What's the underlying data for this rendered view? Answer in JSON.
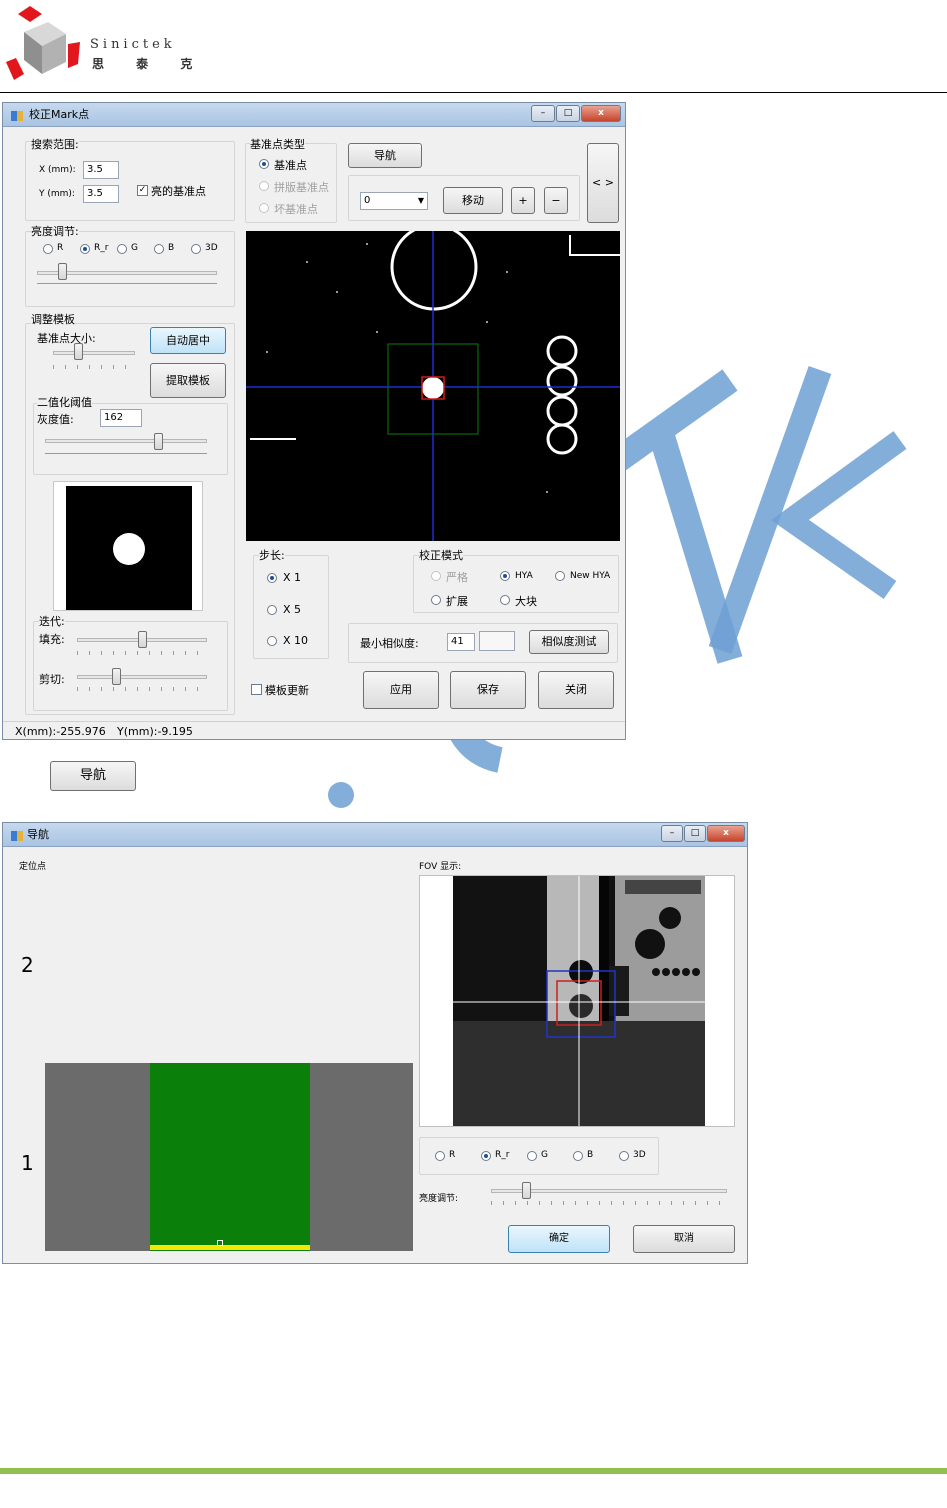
{
  "logo": {
    "name": "Sinictek",
    "cn": "思 泰 克"
  },
  "watermark": {
    "text": "Sinictek",
    "color": "#6ea0d3"
  },
  "win1": {
    "title": "校正Mark点",
    "search": {
      "title": "搜索范围:",
      "x_label": "X (mm):",
      "x_value": "3.5",
      "y_label": "Y (mm):",
      "y_value": "3.5",
      "bright_label": "亮的基准点",
      "bright_checked": true
    },
    "ref_type": {
      "title": "基准点类型",
      "opt1": "基准点",
      "opt2": "拼版基准点",
      "opt3": "坏基准点"
    },
    "nav_button": "导航",
    "move": {
      "select_value": "0",
      "move_button": "移动",
      "plus": "+",
      "minus": "−"
    },
    "side_button": "< >",
    "brightness": {
      "title": "亮度调节:",
      "channels": [
        "R",
        "R_r",
        "G",
        "B",
        "3D"
      ],
      "selected": "R_r",
      "level": 0.14
    },
    "template": {
      "title": "调整模板",
      "size_label": "基准点大小:",
      "size_level": 0.3,
      "auto_center": "自动居中",
      "extract": "提取模板"
    },
    "binar": {
      "title": "二值化阈值",
      "gray_label": "灰度值:",
      "gray_value": "162",
      "gray_level": 0.7
    },
    "iter": {
      "title": "迭代:",
      "fill_label": "填充:",
      "fill_level": 0.5,
      "cut_label": "剪切:",
      "cut_level": 0.3
    },
    "step": {
      "title": "步长:",
      "opt1": "X 1",
      "opt2": "X 5",
      "opt3": "X 10"
    },
    "mode": {
      "title": "校正模式",
      "strict": "严格",
      "hya": "HYA",
      "newhya": "New HYA",
      "expand": "扩展",
      "big": "大块"
    },
    "similarity": {
      "label": "最小相似度:",
      "value": "41",
      "test_button": "相似度测试"
    },
    "template_update": "模板更新",
    "apply": "应用",
    "save": "保存",
    "close": "关闭",
    "status": {
      "x": "X(mm):-255.976",
      "y": "Y(mm):-9.195"
    }
  },
  "caption_button": "导航",
  "win2": {
    "title": "导航",
    "loc_label": "定位点",
    "point2": "2",
    "point1": "1",
    "fov_label": "FOV 显示:",
    "channels": [
      "R",
      "R_r",
      "G",
      "B",
      "3D"
    ],
    "selected": "R_r",
    "brightness_label": "亮度调节:",
    "brightness_level": 0.15,
    "ok": "确定",
    "cancel": "取消",
    "colors": {
      "board": "#0a7f0a",
      "edge": "#f2e800",
      "gray": "#6b6b6b"
    }
  }
}
